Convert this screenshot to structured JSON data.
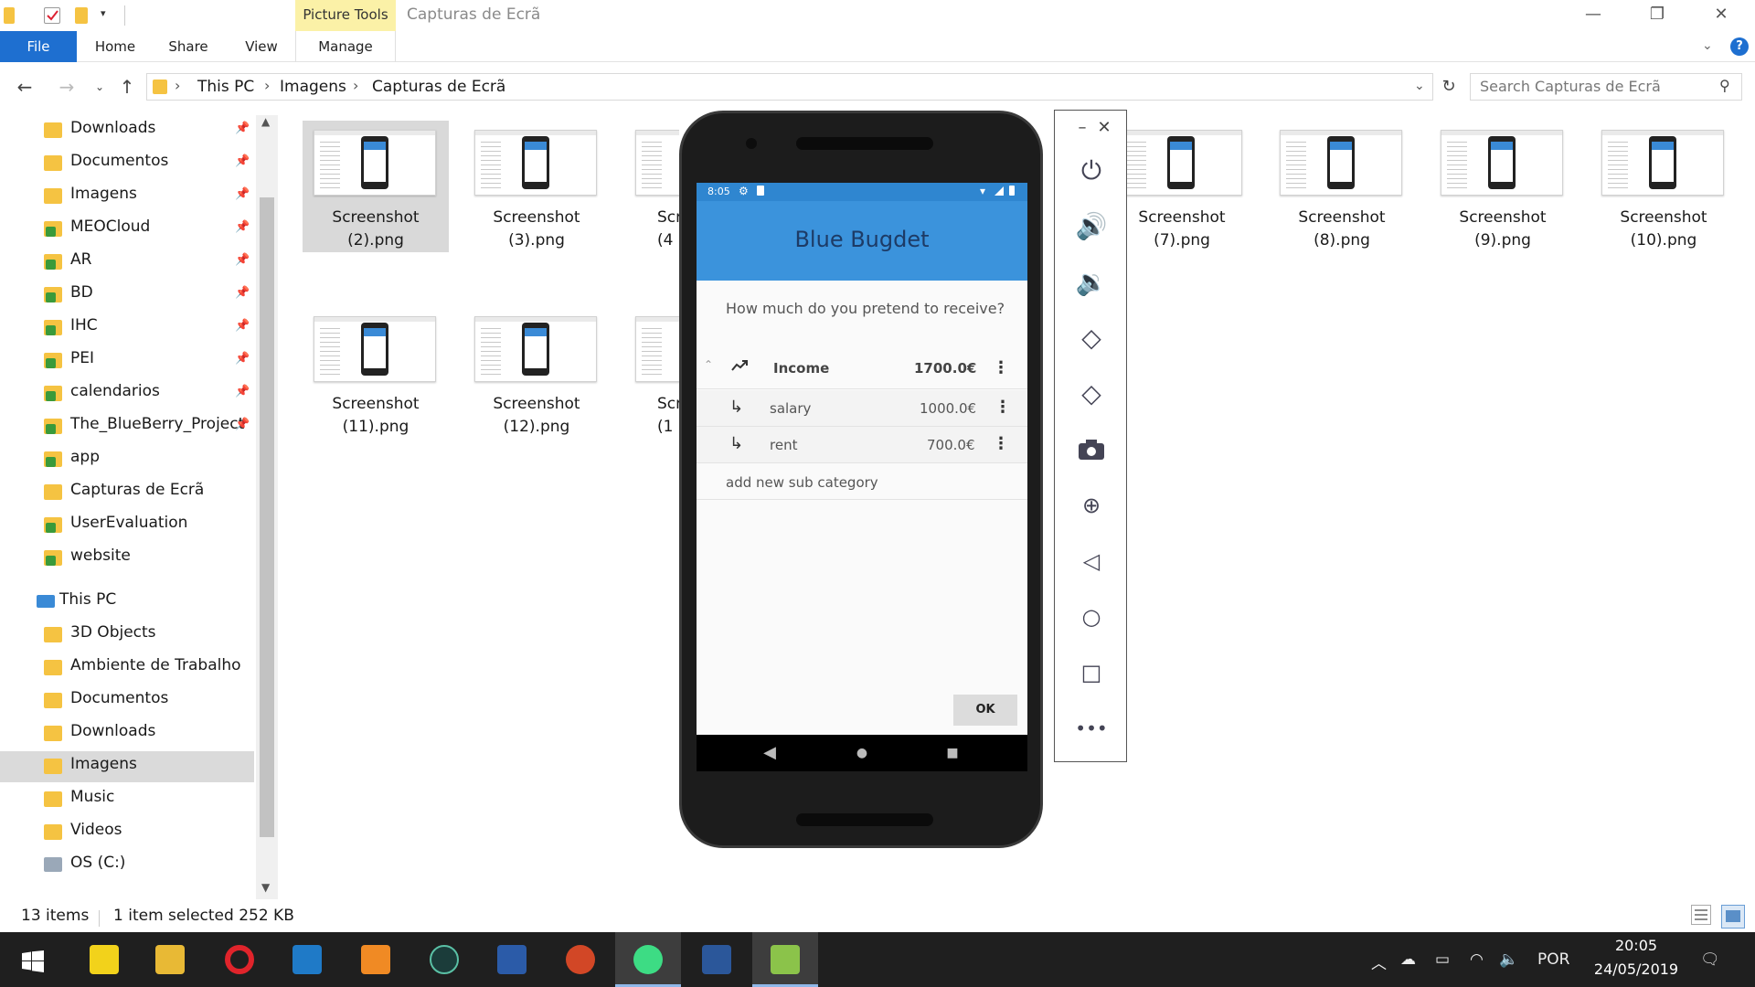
{
  "window": {
    "title": "Capturas de Ecrã",
    "contextual_tab": "Picture Tools",
    "minimize": "—",
    "maximize": "❐",
    "close": "✕"
  },
  "ribbon": {
    "tabs": [
      "File",
      "Home",
      "Share",
      "View",
      "Manage"
    ],
    "help": "?"
  },
  "address": {
    "crumbs": [
      "This PC",
      "Imagens",
      "Capturas de Ecrã"
    ],
    "search_placeholder": "Search Capturas de Ecrã"
  },
  "sidebar": {
    "quick_access": [
      {
        "label": "Downloads",
        "pinned": true,
        "icon": "download-folder-icon"
      },
      {
        "label": "Documentos",
        "pinned": true,
        "icon": "documents-folder-icon"
      },
      {
        "label": "Imagens",
        "pinned": true,
        "icon": "pictures-folder-icon"
      },
      {
        "label": "MEOCloud",
        "pinned": true,
        "icon": "cloud-folder-icon"
      },
      {
        "label": "AR",
        "pinned": true,
        "icon": "synced-folder-icon"
      },
      {
        "label": "BD",
        "pinned": true,
        "icon": "synced-folder-icon"
      },
      {
        "label": "IHC",
        "pinned": true,
        "icon": "synced-folder-icon"
      },
      {
        "label": "PEI",
        "pinned": true,
        "icon": "synced-folder-icon"
      },
      {
        "label": "calendarios",
        "pinned": true,
        "icon": "synced-folder-icon"
      },
      {
        "label": "The_BlueBerry_Project",
        "pinned": true,
        "icon": "synced-folder-icon"
      },
      {
        "label": "app",
        "pinned": false,
        "icon": "synced-folder-icon"
      },
      {
        "label": "Capturas de Ecrã",
        "pinned": false,
        "icon": "folder-icon"
      },
      {
        "label": "UserEvaluation",
        "pinned": false,
        "icon": "synced-folder-icon"
      },
      {
        "label": "website",
        "pinned": false,
        "icon": "synced-folder-icon"
      }
    ],
    "this_pc": "This PC",
    "this_pc_items": [
      {
        "label": "3D Objects",
        "icon": "3d-objects-icon"
      },
      {
        "label": "Ambiente de Trabalho",
        "icon": "desktop-folder-icon"
      },
      {
        "label": "Documentos",
        "icon": "documents-folder-icon"
      },
      {
        "label": "Downloads",
        "icon": "download-folder-icon"
      },
      {
        "label": "Imagens",
        "icon": "pictures-folder-icon",
        "selected": true
      },
      {
        "label": "Music",
        "icon": "music-folder-icon"
      },
      {
        "label": "Videos",
        "icon": "videos-folder-icon"
      },
      {
        "label": "OS (C:)",
        "icon": "drive-icon"
      }
    ]
  },
  "files": [
    {
      "line1": "Screenshot",
      "line2": "(2).png",
      "selected": true
    },
    {
      "line1": "Screenshot",
      "line2": "(3).png"
    },
    {
      "line1": "Scr",
      "line2": "(4"
    },
    {
      "line1": "Screenshot",
      "line2": "(7).png"
    },
    {
      "line1": "Screenshot",
      "line2": "(8).png"
    },
    {
      "line1": "Screenshot",
      "line2": "(9).png"
    },
    {
      "line1": "Screenshot",
      "line2": "(10).png"
    },
    {
      "line1": "Screenshot",
      "line2": "(11).png"
    },
    {
      "line1": "Screenshot",
      "line2": "(12).png"
    },
    {
      "line1": "Scr",
      "line2": "(1"
    }
  ],
  "status": {
    "count": "13 items",
    "selection": "1 item selected  252 KB"
  },
  "app": {
    "time": "8:05",
    "title": "Blue Bugdet",
    "question": "How much do you pretend to receive?",
    "category": {
      "name": "Income",
      "amount": "1700.0€"
    },
    "subcategories": [
      {
        "name": "salary",
        "amount": "1000.0€"
      },
      {
        "name": "rent",
        "amount": "700.0€"
      }
    ],
    "add_label": "add new sub category",
    "ok_label": "OK"
  },
  "emulator_tools": [
    "power-icon",
    "volume-up-icon",
    "volume-down-icon",
    "rotate-left-icon",
    "rotate-right-icon",
    "camera-icon",
    "zoom-icon",
    "back-icon",
    "home-icon",
    "overview-icon",
    "more-icon"
  ],
  "taskbar": {
    "apps": [
      "windows-start-icon",
      "sticky-notes-icon",
      "file-explorer-icon",
      "opera-icon",
      "vscode-icon",
      "pdf-app-icon",
      "gitkraken-icon",
      "powershell-icon",
      "powerpoint-icon",
      "android-studio-icon",
      "word-icon",
      "emulator-icon"
    ],
    "language": "POR",
    "time": "20:05",
    "date": "24/05/2019"
  },
  "colors": {
    "file_tab": "#1e6fd0",
    "app_header": "#3b93dc",
    "app_title": "#1d3b66",
    "taskbar": "#1f1f1f"
  }
}
